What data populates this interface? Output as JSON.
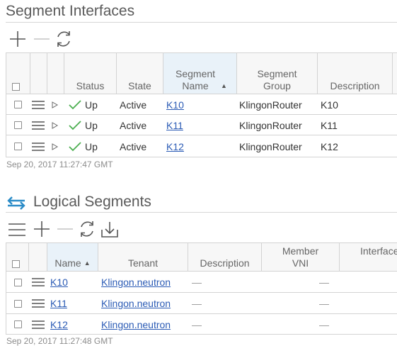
{
  "segment_interfaces": {
    "title": "Segment Interfaces",
    "columns": {
      "status": "Status",
      "state": "State",
      "segment_name": "Segment Name",
      "segment_group": "Segment Group",
      "description": "Description"
    },
    "sort_indicator": "▲",
    "rows": [
      {
        "status": "Up",
        "state": "Active",
        "segment_name": "K10",
        "segment_group": "KlingonRouter",
        "description": "K10"
      },
      {
        "status": "Up",
        "state": "Active",
        "segment_name": "K11",
        "segment_group": "KlingonRouter",
        "description": "K11"
      },
      {
        "status": "Up",
        "state": "Active",
        "segment_name": "K12",
        "segment_group": "KlingonRouter",
        "description": "K12"
      }
    ],
    "timestamp": "Sep 20, 2017 11:27:47 GMT",
    "icons": [
      "add-icon",
      "remove-icon",
      "refresh-icon"
    ]
  },
  "logical_segments": {
    "title": "Logical Segments",
    "columns": {
      "name": "Name",
      "tenant": "Tenant",
      "description": "Description",
      "member_vni": "Member VNI",
      "interface": "Interface"
    },
    "sort_indicator": "▲",
    "rows": [
      {
        "name": "K10",
        "tenant": "Klingon.neutron",
        "description": "—",
        "member_vni": "—"
      },
      {
        "name": "K11",
        "tenant": "Klingon.neutron",
        "description": "—",
        "member_vni": "—"
      },
      {
        "name": "K12",
        "tenant": "Klingon.neutron",
        "description": "—",
        "member_vni": "—"
      }
    ],
    "timestamp": "Sep 20, 2017 11:27:48 GMT",
    "icons": [
      "segments-icon",
      "menu-icon",
      "add-icon",
      "remove-icon",
      "refresh-icon",
      "download-icon"
    ]
  },
  "colors": {
    "link": "#2b5bb5",
    "status_ok": "#4caf50",
    "segments_icon": "#2a8bc7",
    "sorted_header": "#e9f2f9"
  }
}
